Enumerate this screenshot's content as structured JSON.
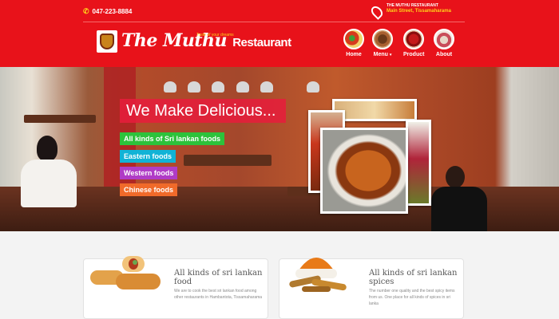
{
  "header": {
    "phone": "047-223-8884",
    "address_name": "THE MUTHU RESTAURANT",
    "address_street": "Main Street, Tissamaharama",
    "logo_the": "The",
    "logo_muthu": "Muthu",
    "logo_restaurant": "Restaurant",
    "tagline": "Taste of your dreams",
    "nav": [
      {
        "label": "Home"
      },
      {
        "label": "Menu"
      },
      {
        "label": "Product"
      },
      {
        "label": "About"
      }
    ]
  },
  "hero": {
    "headline": "We Make Delicious...",
    "tags": [
      "All kinds of Sri lankan foods",
      "Eastern foods",
      "Western foods",
      "Chinese foods"
    ]
  },
  "cards": [
    {
      "title": "All kinds of sri lankan food",
      "text": "We are to cook the best sri lankan food among other restaurants in Hambantota, Tissamaharama"
    },
    {
      "title": "All kinds of sri lankan spices",
      "text": "The number one quality and the best spicy items from us. One place for all kinds of spices in sri lanka"
    }
  ],
  "colors": {
    "header_bg": "#e8121a",
    "accent_yellow": "#ffd21a",
    "headline_bg": "#e81c3c",
    "tag_green": "#2dc23b",
    "tag_blue": "#11b3d6",
    "tag_purple": "#b03cc6",
    "tag_orange": "#f06a2a"
  }
}
